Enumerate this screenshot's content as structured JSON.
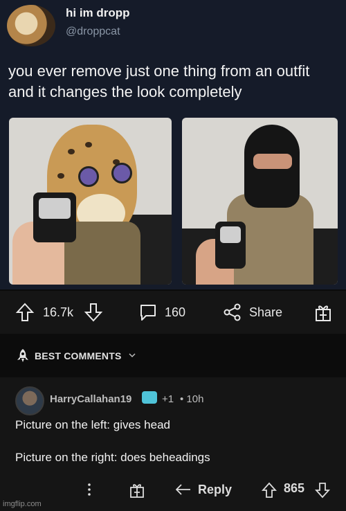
{
  "tweet": {
    "name": "hi im dropp",
    "handle": "@droppcat",
    "text": "you ever remove just one thing from an outfit and it changes the look completely"
  },
  "actions": {
    "upvotes": "16.7k",
    "comments": "160",
    "share": "Share"
  },
  "best_comments": {
    "label": "BEST COMMENTS"
  },
  "comment": {
    "username": "HarryCallahan19",
    "karma": "+1",
    "time": "• 10h",
    "line1": "Picture on the left: gives head",
    "line2": "Picture on the right: does beheadings",
    "reply": "Reply",
    "score": "865"
  },
  "watermark": "imgflip.com",
  "colors": {
    "tweet_bg": "#151b29",
    "bar_bg": "#151515",
    "page_bg": "#0b0b0b",
    "badge": "#4fc3d8"
  }
}
